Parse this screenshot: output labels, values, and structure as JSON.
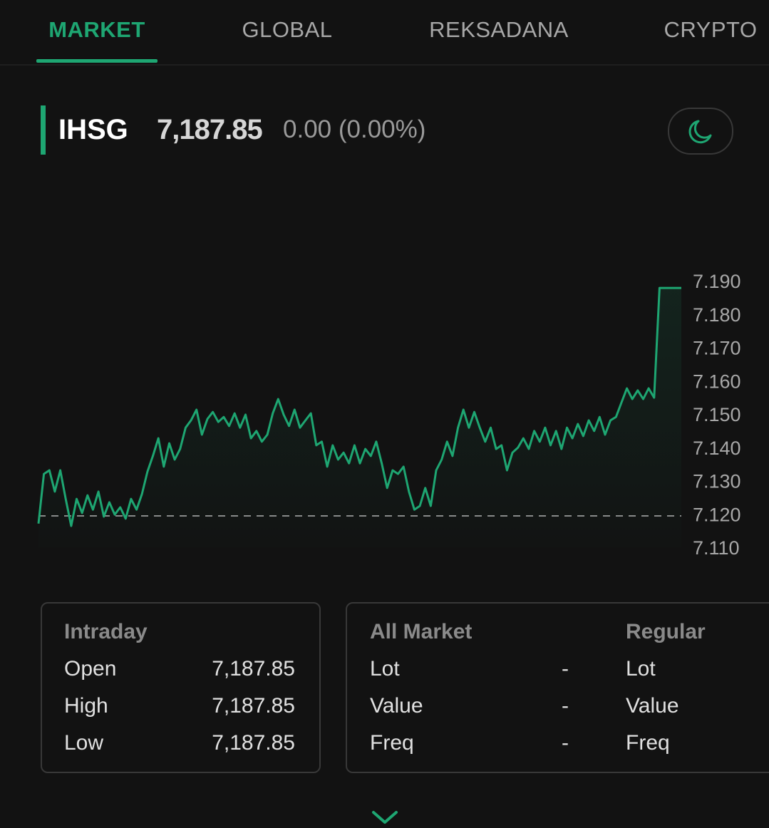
{
  "tabs": [
    {
      "label": "MARKET",
      "active": true
    },
    {
      "label": "GLOBAL",
      "active": false
    },
    {
      "label": "REKSADANA",
      "active": false
    },
    {
      "label": "CRYPTO",
      "active": false
    }
  ],
  "quote": {
    "symbol": "IHSG",
    "last": "7,187.85",
    "change": "0.00 (0.00%)",
    "theme_icon": "moon-icon"
  },
  "colors": {
    "accent": "#1ea672",
    "background": "#121212",
    "line": "#1ea672"
  },
  "chart_data": {
    "type": "area",
    "title": "",
    "xlabel": "",
    "ylabel": "",
    "ylim": [
      7108,
      7192
    ],
    "y_ticks": [
      7190,
      7180,
      7170,
      7160,
      7150,
      7140,
      7130,
      7120,
      7110
    ],
    "y_tick_labels": [
      "7.190",
      "7.180",
      "7.170",
      "7.160",
      "7.150",
      "7.140",
      "7.130",
      "7.120",
      "7.110"
    ],
    "reference_line": 7119.4,
    "grid": false,
    "series": [
      {
        "values": [
          7117.1,
          7132.0,
          7133.1,
          7126.7,
          7133.1,
          7124.5,
          7116.4,
          7124.5,
          7120.3,
          7125.6,
          7121.3,
          7126.7,
          7119.2,
          7123.5,
          7119.8,
          7122.0,
          7118.6,
          7124.5,
          7121.3,
          7126.0,
          7132.7,
          7137.4,
          7142.7,
          7134.2,
          7141.2,
          7136.3,
          7139.5,
          7145.9,
          7148.1,
          7151.3,
          7143.8,
          7148.5,
          7150.6,
          7147.6,
          7149.1,
          7146.4,
          7150.2,
          7145.9,
          7149.8,
          7142.7,
          7144.9,
          7141.7,
          7143.8,
          7150.2,
          7154.5,
          7149.8,
          7146.4,
          7151.3,
          7145.9,
          7148.1,
          7150.2,
          7140.6,
          7141.7,
          7134.2,
          7140.6,
          7136.3,
          7138.4,
          7135.2,
          7140.6,
          7135.2,
          7139.5,
          7137.4,
          7141.7,
          7135.2,
          7127.8,
          7133.1,
          7132.0,
          7134.2,
          7126.7,
          7121.3,
          7122.4,
          7127.8,
          7122.4,
          7133.1,
          7136.3,
          7141.7,
          7137.4,
          7145.9,
          7151.3,
          7145.9,
          7150.6,
          7145.9,
          7141.7,
          7145.9,
          7139.5,
          7140.6,
          7133.1,
          7138.4,
          7139.9,
          7142.7,
          7139.5,
          7144.9,
          7141.7,
          7145.9,
          7140.6,
          7144.9,
          7139.5,
          7145.9,
          7142.7,
          7147.0,
          7143.4,
          7148.1,
          7144.9,
          7149.1,
          7143.8,
          7148.1,
          7149.1,
          7153.4,
          7157.7,
          7154.5,
          7157.1,
          7154.5,
          7157.7,
          7154.9,
          7187.85,
          7187.85,
          7187.85,
          7187.85,
          7187.85
        ]
      }
    ]
  },
  "intraday": {
    "heading": "Intraday",
    "rows": [
      {
        "label": "Open",
        "value": "7,187.85"
      },
      {
        "label": "High",
        "value": "7,187.85"
      },
      {
        "label": "Low",
        "value": "7,187.85"
      }
    ]
  },
  "all_market": {
    "heading": "All Market",
    "rows": [
      {
        "label": "Lot",
        "value": "-"
      },
      {
        "label": "Value",
        "value": "-"
      },
      {
        "label": "Freq",
        "value": "-"
      }
    ]
  },
  "regular": {
    "heading": "Regular",
    "rows": [
      {
        "label": "Lot"
      },
      {
        "label": "Value"
      },
      {
        "label": "Freq"
      }
    ]
  },
  "expand_icon": "chevron-down-icon"
}
